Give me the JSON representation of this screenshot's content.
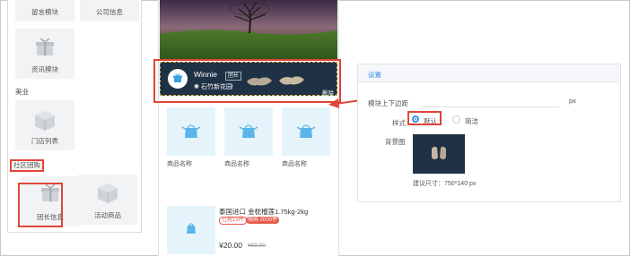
{
  "component_library": {
    "tiles": [
      {
        "label": "留言模块",
        "icon": "message-icon"
      },
      {
        "label": "公司信息",
        "icon": "company-icon"
      },
      {
        "label": "资讯模块",
        "icon": "news-gift-icon"
      },
      {
        "label": "门店列表",
        "icon": "store-box-icon"
      },
      {
        "label": "团长信息",
        "icon": "leader-gift-icon"
      },
      {
        "label": "活动商品",
        "icon": "activity-box-icon"
      }
    ],
    "sections": {
      "beauty": "美业",
      "community_group": "社区团购"
    }
  },
  "preview": {
    "leader_card": {
      "name": "Winnie",
      "role_badge": "团长",
      "location": "石竹新花园",
      "delete_label": "删除"
    },
    "product_grid": [
      {
        "name": "商品名称"
      },
      {
        "name": "商品名称"
      },
      {
        "name": "商品名称"
      }
    ],
    "product_item": {
      "title": "泰国进口 金枕榴莲1.75kg-2kg",
      "tag_sold": "已抢15件",
      "tag_limit": "限购 2000件",
      "price": "¥20.00",
      "original_price": "¥89.90"
    }
  },
  "settings": {
    "title": "设置",
    "margin_label": "模块上下边距",
    "margin_unit": "px",
    "style_label": "样式",
    "style_options": [
      "默认",
      "简洁"
    ],
    "style_selected": "默认",
    "background_label": "背景图",
    "size_hint": "建议尺寸：750*140 px"
  },
  "colors": {
    "accent": "#3a8ee6",
    "highlight": "#e0453a",
    "leader_bg": "#1f3144",
    "product_tile": "#e5f4fb"
  }
}
